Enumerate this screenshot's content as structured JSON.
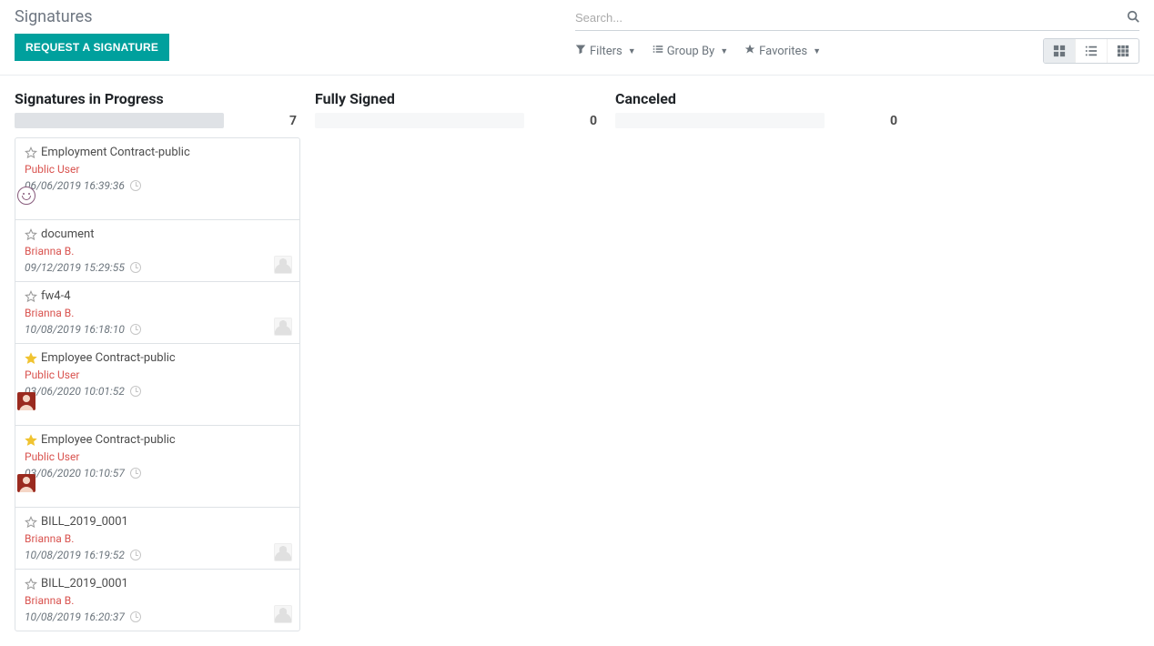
{
  "header": {
    "title": "Signatures",
    "primary_button": "REQUEST A SIGNATURE"
  },
  "search": {
    "placeholder": "Search..."
  },
  "controls": {
    "filters_label": "Filters",
    "groupby_label": "Group By",
    "favorites_label": "Favorites"
  },
  "columns": [
    {
      "title": "Signatures in Progress",
      "count": "7",
      "filled": true,
      "cards": [
        {
          "starred": false,
          "title": "Employment Contract-public",
          "user": "Public User",
          "date": "06/06/2019 16:39:36",
          "avatar": "smiley"
        },
        {
          "starred": false,
          "title": "document",
          "user": "Brianna B.",
          "date": "09/12/2019 15:29:55",
          "avatar": "placeholder"
        },
        {
          "starred": false,
          "title": "fw4-4",
          "user": "Brianna B.",
          "date": "10/08/2019 16:18:10",
          "avatar": "placeholder"
        },
        {
          "starred": true,
          "title": "Employee Contract-public",
          "user": "Public User",
          "date": "03/06/2020 10:01:52",
          "avatar": "red"
        },
        {
          "starred": true,
          "title": "Employee Contract-public",
          "user": "Public User",
          "date": "03/06/2020 10:10:57",
          "avatar": "red"
        },
        {
          "starred": false,
          "title": "BILL_2019_0001",
          "user": "Brianna B.",
          "date": "10/08/2019 16:19:52",
          "avatar": "placeholder"
        },
        {
          "starred": false,
          "title": "BILL_2019_0001",
          "user": "Brianna B.",
          "date": "10/08/2019 16:20:37",
          "avatar": "placeholder"
        }
      ]
    },
    {
      "title": "Fully Signed",
      "count": "0",
      "filled": false,
      "cards": []
    },
    {
      "title": "Canceled",
      "count": "0",
      "filled": false,
      "cards": []
    }
  ]
}
